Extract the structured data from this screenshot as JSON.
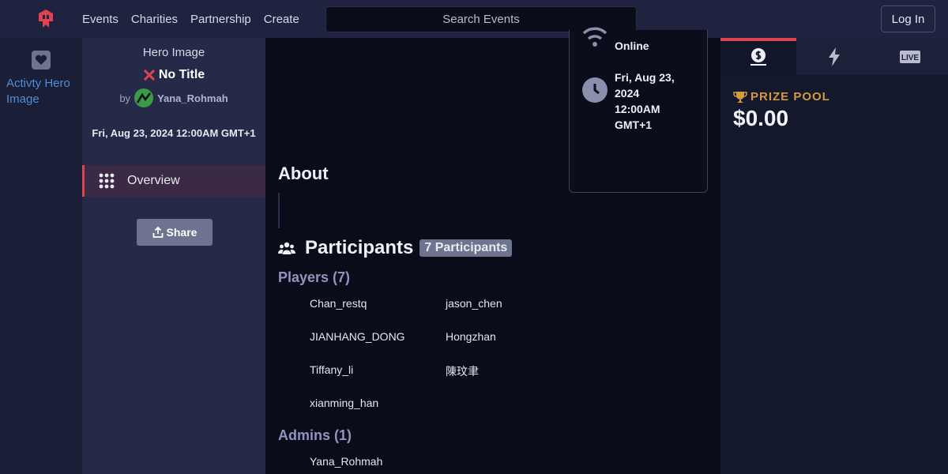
{
  "nav": {
    "links": [
      "Events",
      "Charities",
      "Partnership",
      "Create"
    ],
    "search_placeholder": "Search Events",
    "login_label": "Log In"
  },
  "rail": {
    "activity_alt": "Activty Hero Image"
  },
  "sidebar": {
    "hero_alt": "Hero Image",
    "title": "No Title",
    "by_label": "by",
    "author": "Yana_Rohmah",
    "date": "Fri, Aug 23, 2024 12:00AM GMT+1",
    "overview_label": "Overview",
    "share_label": "Share"
  },
  "info": {
    "location": "Online",
    "datetime_lines": [
      "Fri, Aug 23,",
      "2024",
      "12:00AM",
      "GMT+1"
    ]
  },
  "about": {
    "heading": "About"
  },
  "participants": {
    "heading": "Participants",
    "badge": "7 Participants",
    "players_heading": "Players (7)",
    "players": [
      "Chan_restq",
      "jason_chen",
      "JIANHANG_DONG",
      "Hongzhan",
      "Tiffany_li",
      "陳玟聿",
      "xianming_han"
    ],
    "admins_heading": "Admins (1)",
    "admins": [
      "Yana_Rohmah"
    ]
  },
  "right": {
    "tabs": [
      "money-icon",
      "bolt-icon",
      "live-icon"
    ],
    "live_label": "LIVE",
    "prize_label": "PRIZE POOL",
    "prize_value": "$0.00"
  },
  "colors": {
    "accent": "#e0434f",
    "prize": "#d39a3e",
    "nav_bg": "#1f2340",
    "sidebar_bg": "#252a48"
  }
}
